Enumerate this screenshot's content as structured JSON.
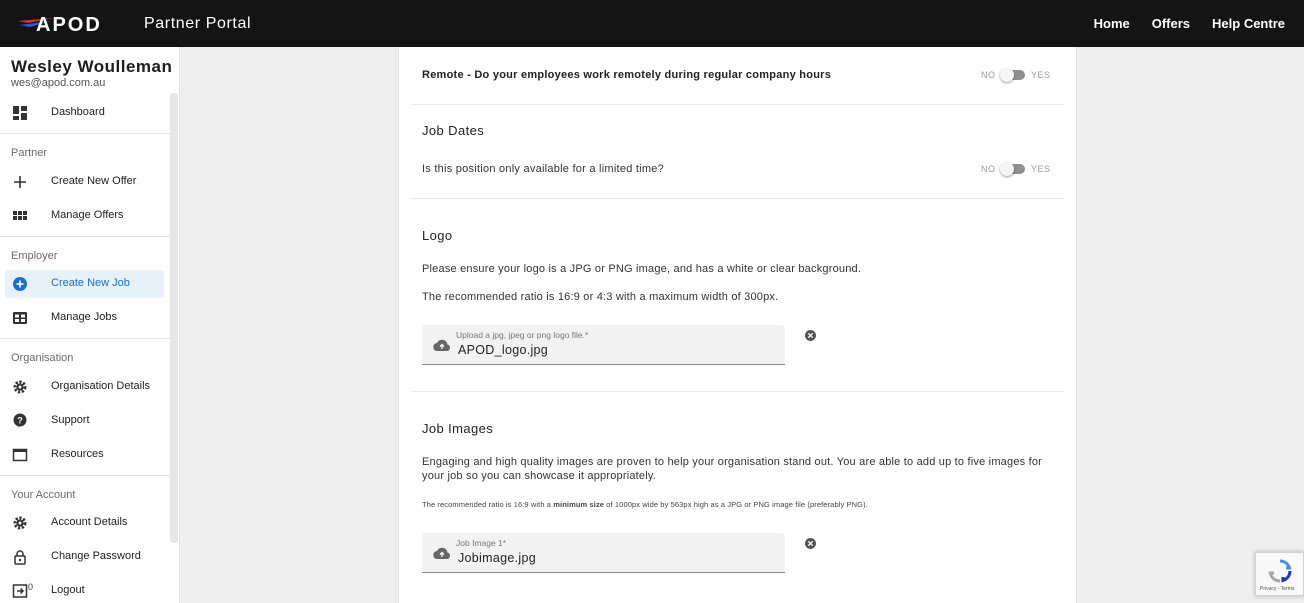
{
  "header": {
    "logo_text": "APOD",
    "portal_title": "Partner Portal",
    "nav": [
      "Home",
      "Offers",
      "Help Centre"
    ]
  },
  "sidebar": {
    "user_name": "Wesley Woulleman",
    "user_email": "wes@apod.com.au",
    "dashboard": "Dashboard",
    "section_partner": "Partner",
    "create_offer": "Create New Offer",
    "manage_offers": "Manage Offers",
    "section_employer": "Employer",
    "create_job": "Create New Job",
    "manage_jobs": "Manage Jobs",
    "section_org": "Organisation",
    "org_details": "Organisation Details",
    "support": "Support",
    "resources": "Resources",
    "section_account": "Your Account",
    "account_details": "Account Details",
    "change_password": "Change Password",
    "logout": "Logout",
    "version": "0"
  },
  "form": {
    "remote_question": "Remote - Do your employees work remotely during regular company hours",
    "toggle_no": "NO",
    "toggle_yes": "YES",
    "job_dates_heading": "Job Dates",
    "limited_question": "Is this position only available for a limited time?",
    "logo_heading": "Logo",
    "logo_text_1": "Please ensure your logo is a JPG or PNG image, and has a white or clear background.",
    "logo_text_2": "The recommended ratio is 16:9 or 4:3 with a maximum width of 300px.",
    "logo_upload_label": "Upload a jpg, jpeg or png logo file.*",
    "logo_upload_value": "APOD_logo.jpg",
    "images_heading": "Job Images",
    "images_text": "Engaging and high quality images are proven to help your organisation stand out. You are able to add up to five images for your job so you can showcase it appropriately.",
    "images_small_pre": "The recommended ratio is 16:9 with a",
    "images_small_bold": "minimum size",
    "images_small_post": "of 1000px wide by 563px high as a JPG or PNG image file (preferably PNG).",
    "image1_label": "Job Image 1*",
    "image1_value": "Jobimage.jpg"
  },
  "recaptcha": {
    "text": "Privacy - Terms"
  },
  "colors": {
    "header_bg": "#141414",
    "active_bg": "#e8f0fa",
    "active_text": "#1d6fc5",
    "logo_accent": "#d8332a"
  }
}
